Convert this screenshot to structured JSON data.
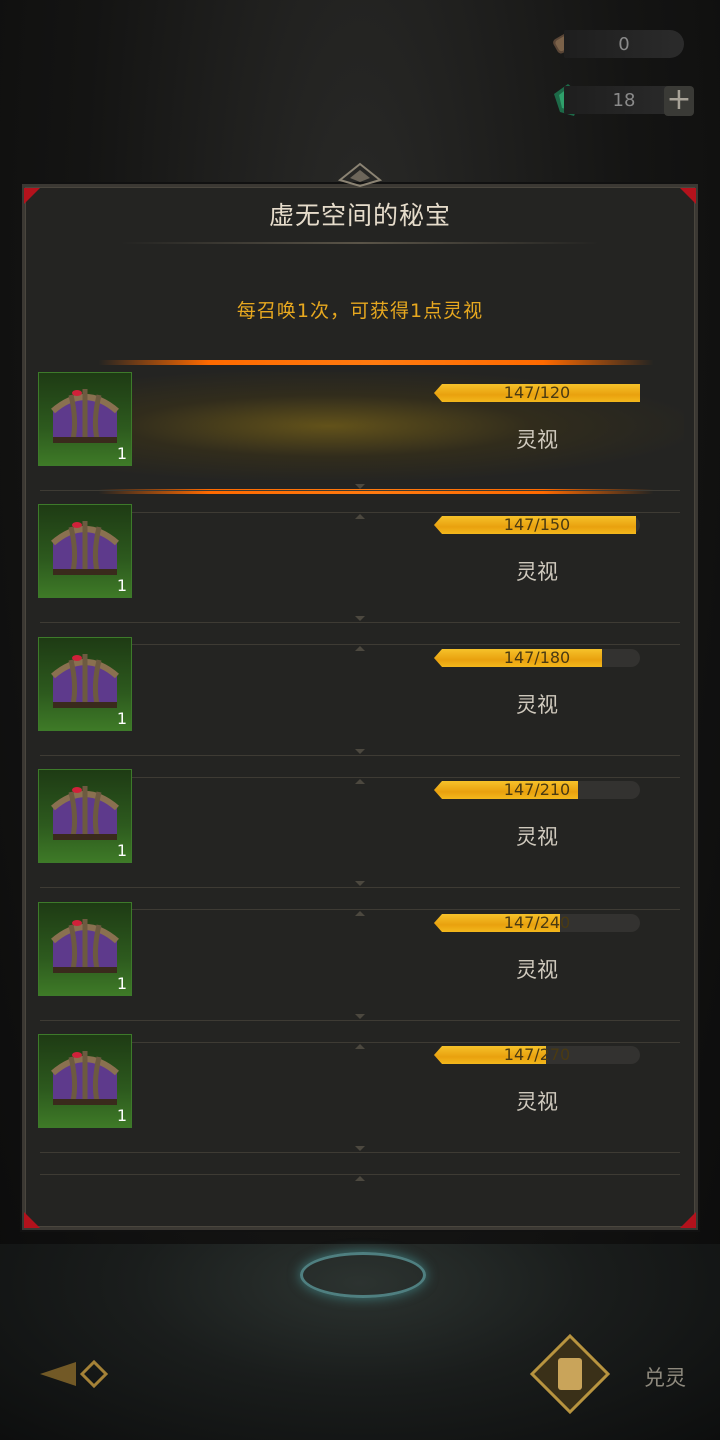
{
  "resources": [
    {
      "icon": "scroll-icon",
      "value": "0"
    },
    {
      "icon": "green-crystal-icon",
      "value": "18",
      "has_plus": true
    }
  ],
  "panel": {
    "title": "虚无空间的秘宝",
    "subtitle": "每召唤1次，可获得1点灵视"
  },
  "rows": [
    {
      "item_icon": "purple-chest-icon",
      "quantity": "1",
      "progress_text": "147/120",
      "progress": 1.0,
      "reward": "灵视",
      "highlighted": true
    },
    {
      "item_icon": "purple-chest-icon",
      "quantity": "1",
      "progress_text": "147/150",
      "progress": 0.98,
      "reward": "灵视"
    },
    {
      "item_icon": "purple-chest-icon",
      "quantity": "1",
      "progress_text": "147/180",
      "progress": 0.8167,
      "reward": "灵视"
    },
    {
      "item_icon": "purple-chest-icon",
      "quantity": "1",
      "progress_text": "147/210",
      "progress": 0.7,
      "reward": "灵视"
    },
    {
      "item_icon": "purple-chest-icon",
      "quantity": "1",
      "progress_text": "147/240",
      "progress": 0.6125,
      "reward": "灵视"
    },
    {
      "item_icon": "purple-chest-icon",
      "quantity": "1",
      "progress_text": "147/270",
      "progress": 0.5444,
      "reward": "灵视"
    }
  ],
  "bottom": {
    "right_button_label": "兑灵"
  },
  "colors": {
    "accent_gold": "#e7a81f",
    "progress_fill": "#f0b21a",
    "highlight_orange": "#ff6a00"
  }
}
